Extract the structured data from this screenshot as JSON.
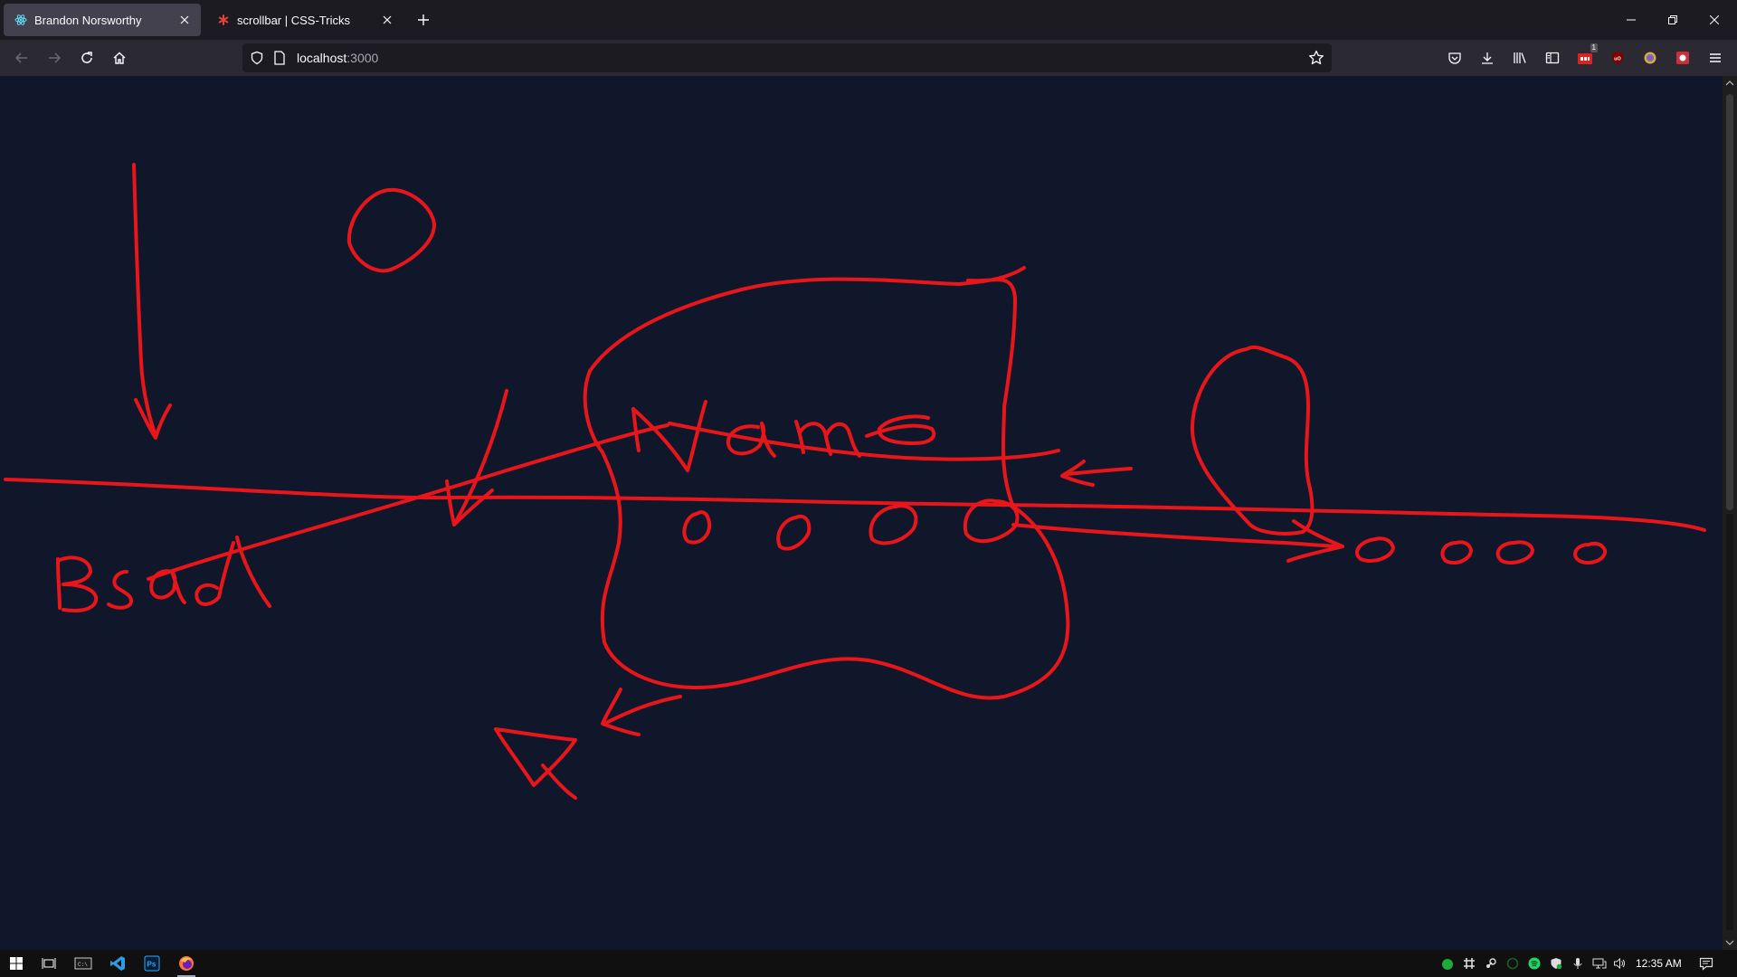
{
  "browser": {
    "tabs": [
      {
        "title": "Brandon Norsworthy",
        "favicon": "react-icon",
        "active": true
      },
      {
        "title": "scrollbar | CSS-Tricks",
        "favicon": "css-tricks-asterisk-icon",
        "active": false
      }
    ],
    "url": {
      "host": "localhost",
      "port": ":3000"
    },
    "accent_color": "#42414d"
  },
  "toolbar": {
    "badge_count": "1"
  },
  "canvas": {
    "background": "#11172a",
    "stroke_color": "#e8161b",
    "drawing": "freehand red sketch"
  },
  "taskbar": {
    "time": "12:35 AM"
  }
}
